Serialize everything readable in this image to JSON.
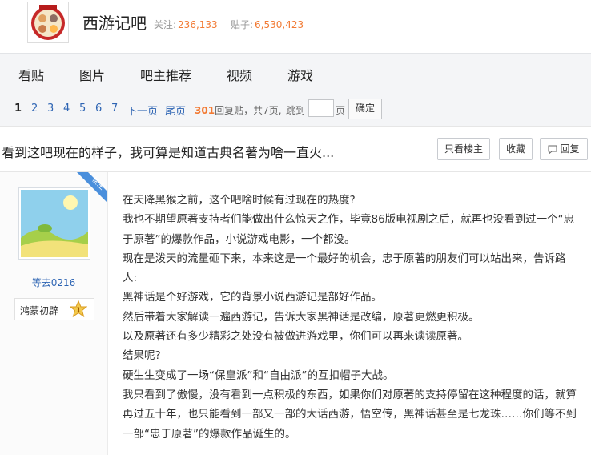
{
  "forum": {
    "name": "西游记吧",
    "follow_label": "关注:",
    "follow_count": "236,133",
    "posts_label": "贴子:",
    "posts_count": "6,530,423"
  },
  "nav": {
    "items": [
      "看贴",
      "图片",
      "吧主推荐",
      "视频",
      "游戏"
    ]
  },
  "pager": {
    "pages": [
      "1",
      "2",
      "3",
      "4",
      "5",
      "6",
      "7"
    ],
    "current": "1",
    "next": "下一页",
    "last": "尾页",
    "reply_count": "301",
    "reply_text": "回复贴，共7页,",
    "jump_label": "跳到",
    "jump_value": "",
    "page_label": "页",
    "confirm": "确定"
  },
  "thread": {
    "title": "看到这吧现在的样子，我可算是知道古典名著为啥一直火...",
    "only_op_label": "只看楼主",
    "favorite_label": "收藏",
    "reply_label": "回复"
  },
  "post": {
    "op_badge": "楼主",
    "author": "等去0216",
    "level_name": "鸿蒙初辟",
    "level_number": "1",
    "lines": [
      "在天降黑猴之前，这个吧啥时候有过现在的热度?",
      "我也不期望原著支持者们能做出什么惊天之作，毕竟86版电视剧之后，就再也没看到过一个“忠于原著”的爆款作品，小说游戏电影，一个都没。",
      "现在是泼天的流量砸下来，本来这是一个最好的机会，忠于原著的朋友们可以站出来，告诉路人:",
      "黑神话是个好游戏，它的背景小说西游记是部好作品。",
      "然后带着大家解读一遍西游记，告诉大家黑神话是改编，原著更燃更积极。",
      "以及原著还有多少精彩之处没有被做进游戏里，你们可以再来读读原著。",
      "结果呢?",
      "硬生生变成了一场“保皇派”和“自由派”的互扣帽子大战。",
      "我只看到了傲慢，没有看到一点积极的东西，如果你们对原著的支持停留在这种程度的话，就算再过五十年，也只能看到一部又一部的大话西游，悟空传，黑神话甚至是七龙珠……你们等不到一部“忠于原著”的爆款作品诞生的。"
    ]
  },
  "colors": {
    "link": "#2d64b3",
    "accent": "#f27a33",
    "op_badge": "#4a8fdc"
  }
}
